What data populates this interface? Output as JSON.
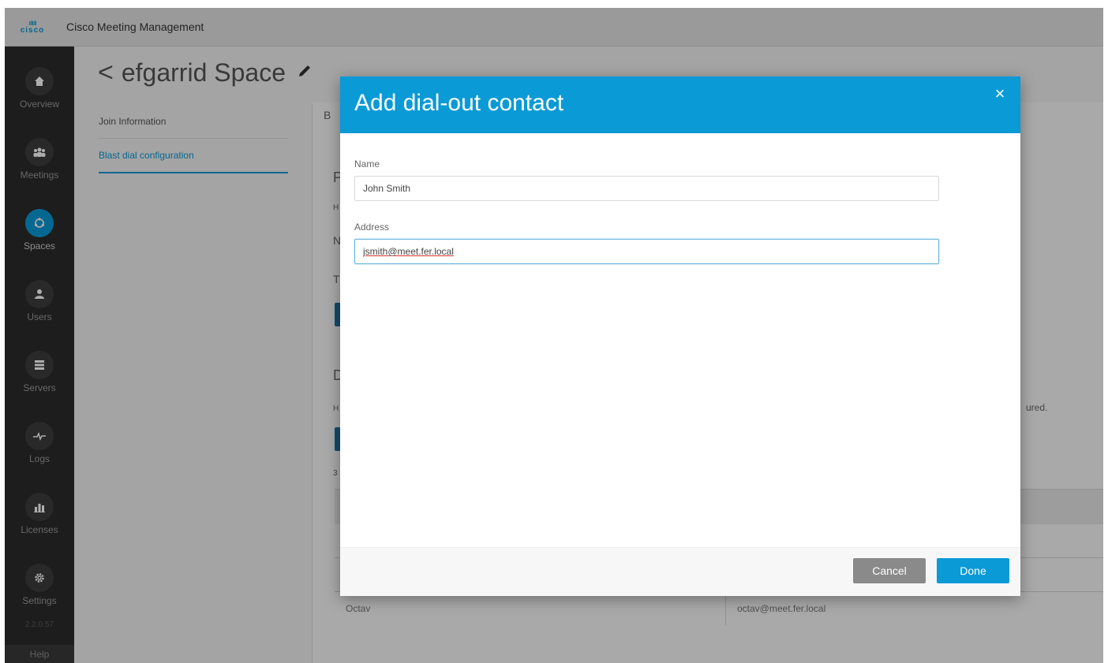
{
  "app": {
    "brand": "cisco",
    "title": "Cisco Meeting Management"
  },
  "sidebar": {
    "items": [
      {
        "label": "Overview",
        "icon": "home-icon"
      },
      {
        "label": "Meetings",
        "icon": "people-icon"
      },
      {
        "label": "Spaces",
        "icon": "spaces-icon",
        "active": true
      },
      {
        "label": "Users",
        "icon": "user-icon"
      },
      {
        "label": "Servers",
        "icon": "servers-icon"
      },
      {
        "label": "Logs",
        "icon": "pulse-icon"
      },
      {
        "label": "Licenses",
        "icon": "bar-chart-icon"
      },
      {
        "label": "Settings",
        "icon": "gear-icon"
      }
    ],
    "version": "2.2.0.57",
    "help": "Help"
  },
  "page": {
    "back_glyph": "<",
    "title": "efgarrid Space",
    "subnav": [
      "Join Information",
      "Blast dial configuration"
    ],
    "background_fragments": [
      "B",
      "P",
      "H",
      "N",
      "T",
      "D",
      "H",
      "3",
      "ured."
    ],
    "table": [
      {
        "name": "",
        "address": ""
      },
      {
        "name": "Octav",
        "address": "octav@meet.fer.local"
      }
    ]
  },
  "modal": {
    "title": "Add dial-out contact",
    "close_glyph": "×",
    "name_label": "Name",
    "name_value": "John Smith",
    "address_label": "Address",
    "address_value": "jsmith@meet.fer.local",
    "cancel_label": "Cancel",
    "done_label": "Done"
  },
  "colors": {
    "accent": "#0a9ad6",
    "sidebar": "#2b2b2b",
    "cancel": "#8a8a8a"
  }
}
